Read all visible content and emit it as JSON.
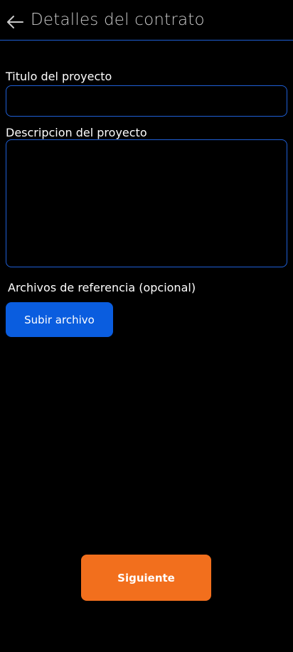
{
  "header": {
    "title": "Detalles del contrato",
    "back_icon": "arrow-left-icon"
  },
  "form": {
    "title_label": "Titulo del proyecto",
    "title_value": "",
    "description_label": "Descripcion del proyecto",
    "description_value": "",
    "files_label": "Archivos de referencia (opcional)",
    "upload_label": "Subir archivo"
  },
  "footer": {
    "next_label": "Siguiente"
  },
  "colors": {
    "background": "#000000",
    "border_blue": "#1f5fd6",
    "upload_blue": "#0a5ddf",
    "next_orange": "#f26f1d"
  }
}
